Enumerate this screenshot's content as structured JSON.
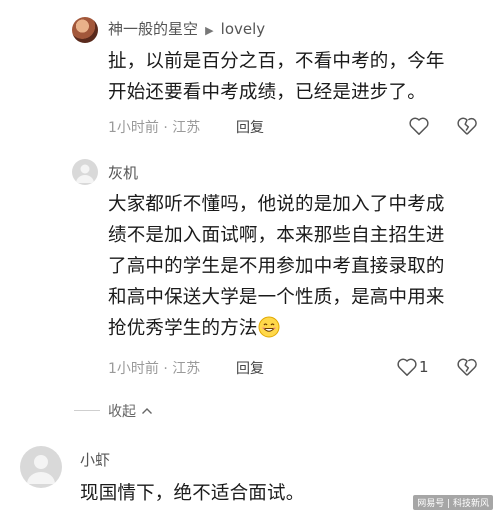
{
  "comments": [
    {
      "user": "神一般的星空",
      "reply_to": "lovely",
      "text_lines": [
        "扯，以前是百分之百，不看中考的，今年",
        "开始还要看中考成绩，已经是进步了。"
      ],
      "meta": "1小时前 · 江苏",
      "reply_label": "回复"
    },
    {
      "user": "灰机",
      "text_lines": [
        "大家都听不懂吗，他说的是加入了中考成",
        "绩不是加入面试啊，本来那些自主招生进",
        "了高中的学生是不用参加中考直接录取的",
        "和高中保送大学是一个性质，是高中用来",
        "抢优秀学生的方法"
      ],
      "meta": "1小时前 · 江苏",
      "reply_label": "回复",
      "like_count": "1"
    },
    {
      "user": "小虾",
      "text_lines": [
        "现国情下，绝不适合面试。"
      ]
    }
  ],
  "collapse_label": "收起",
  "watermark": "网易号 | 科技新风",
  "icons": {
    "reply_arrow": "caret-right-icon",
    "like": "heart-icon",
    "dislike": "broken-heart-icon",
    "collapse": "chevron-up-icon",
    "smile": "smiling-emoji-icon"
  }
}
